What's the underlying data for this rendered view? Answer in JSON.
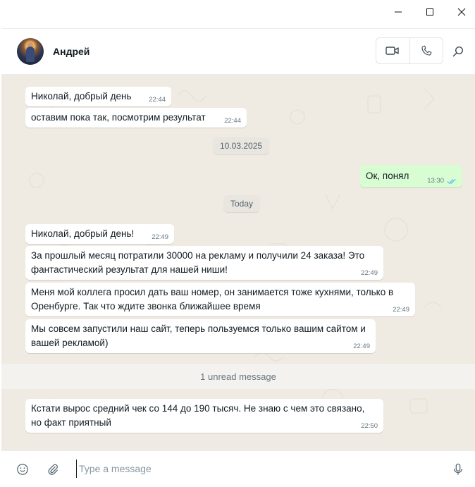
{
  "header": {
    "contact_name": "Андрей",
    "icons": [
      "video-call-icon",
      "voice-call-icon",
      "search-icon"
    ]
  },
  "messages": [
    {
      "direction": "in",
      "text": "Николай, добрый день",
      "time": "22:44"
    },
    {
      "direction": "in",
      "text": "оставим пока так, посмотрим результат",
      "time": "22:44"
    },
    {
      "type": "date",
      "text": "10.03.2025"
    },
    {
      "direction": "out",
      "text": "Ок, понял",
      "time": "13:30",
      "status": "read"
    },
    {
      "type": "date",
      "text": "Today"
    },
    {
      "direction": "in",
      "text": "Николай, добрый день!",
      "time": "22:49"
    },
    {
      "direction": "in",
      "text": "За прошлый месяц потратили 30000 на рекламу и получили 24 заказа! Это фантастический результат для нашей ниши!",
      "time": "22:49"
    },
    {
      "direction": "in",
      "text": "Меня мой коллега просил дать ваш номер, он занимается тоже кухнями, только в Оренбурге. Так что ждите звонка ближайшее время",
      "time": "22:49"
    },
    {
      "direction": "in",
      "text": "Мы совсем запустили наш сайт, теперь пользуемся только вашим сайтом и вашей рекламой)",
      "time": "22:49"
    },
    {
      "type": "unread",
      "text": "1 unread message"
    },
    {
      "direction": "in",
      "text": "Кстати вырос средний чек со 144 до 190 тысяч. Не знаю с чем это связано, но факт приятный",
      "time": "22:50"
    }
  ],
  "composer": {
    "placeholder": "Type a message",
    "value": "",
    "icons": [
      "emoji-icon",
      "attach-icon",
      "microphone-icon"
    ]
  },
  "colors": {
    "chat_background": "#efeae2",
    "incoming_bubble": "#ffffff",
    "outgoing_bubble": "#d9fdd3",
    "read_tick": "#53bdeb"
  }
}
